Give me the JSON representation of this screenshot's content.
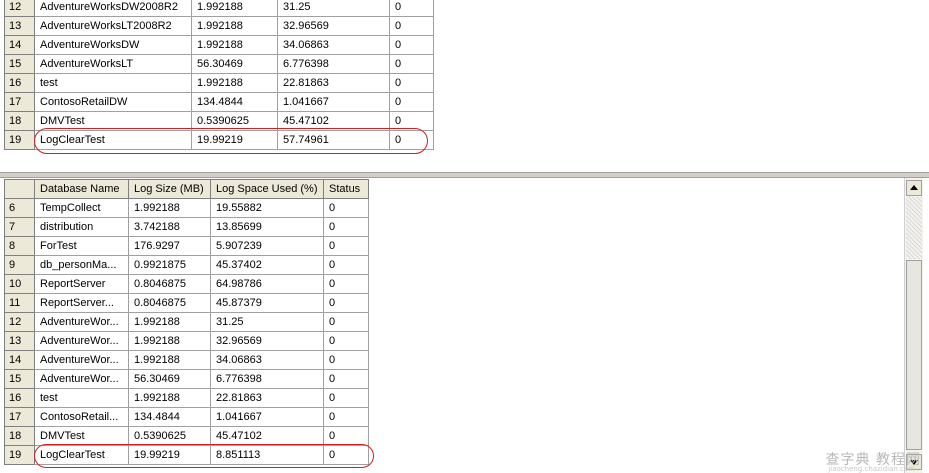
{
  "top_grid": {
    "rows": [
      {
        "n": "12",
        "name": "AdventureWorksDW2008R2",
        "size": "1.992188",
        "used": "31.25",
        "status": "0"
      },
      {
        "n": "13",
        "name": "AdventureWorksLT2008R2",
        "size": "1.992188",
        "used": "32.96569",
        "status": "0"
      },
      {
        "n": "14",
        "name": "AdventureWorksDW",
        "size": "1.992188",
        "used": "34.06863",
        "status": "0"
      },
      {
        "n": "15",
        "name": "AdventureWorksLT",
        "size": "56.30469",
        "used": "6.776398",
        "status": "0"
      },
      {
        "n": "16",
        "name": "test",
        "size": "1.992188",
        "used": "22.81863",
        "status": "0"
      },
      {
        "n": "17",
        "name": "ContosoRetailDW",
        "size": "134.4844",
        "used": "1.041667",
        "status": "0"
      },
      {
        "n": "18",
        "name": "DMVTest",
        "size": "0.5390625",
        "used": "45.47102",
        "status": "0"
      },
      {
        "n": "19",
        "name": "LogClearTest",
        "size": "19.99219",
        "used": "57.74961",
        "status": "0"
      }
    ]
  },
  "bottom_grid": {
    "headers": {
      "name": "Database Name",
      "size": "Log Size (MB)",
      "used": "Log Space Used (%)",
      "status": "Status"
    },
    "rows": [
      {
        "n": "6",
        "name": "TempCollect",
        "size": "1.992188",
        "used": "19.55882",
        "status": "0"
      },
      {
        "n": "7",
        "name": "distribution",
        "size": "3.742188",
        "used": "13.85699",
        "status": "0"
      },
      {
        "n": "8",
        "name": "ForTest",
        "size": "176.9297",
        "used": "5.907239",
        "status": "0"
      },
      {
        "n": "9",
        "name": "db_personMa...",
        "size": "0.9921875",
        "used": "45.37402",
        "status": "0"
      },
      {
        "n": "10",
        "name": "ReportServer",
        "size": "0.8046875",
        "used": "64.98786",
        "status": "0"
      },
      {
        "n": "11",
        "name": "ReportServer...",
        "size": "0.8046875",
        "used": "45.87379",
        "status": "0"
      },
      {
        "n": "12",
        "name": "AdventureWor...",
        "size": "1.992188",
        "used": "31.25",
        "status": "0"
      },
      {
        "n": "13",
        "name": "AdventureWor...",
        "size": "1.992188",
        "used": "32.96569",
        "status": "0"
      },
      {
        "n": "14",
        "name": "AdventureWor...",
        "size": "1.992188",
        "used": "34.06863",
        "status": "0"
      },
      {
        "n": "15",
        "name": "AdventureWor...",
        "size": "56.30469",
        "used": "6.776398",
        "status": "0"
      },
      {
        "n": "16",
        "name": "test",
        "size": "1.992188",
        "used": "22.81863",
        "status": "0"
      },
      {
        "n": "17",
        "name": "ContosoRetail...",
        "size": "134.4844",
        "used": "1.041667",
        "status": "0"
      },
      {
        "n": "18",
        "name": "DMVTest",
        "size": "0.5390625",
        "used": "45.47102",
        "status": "0"
      },
      {
        "n": "19",
        "name": "LogClearTest",
        "size": "19.99219",
        "used": "8.851113",
        "status": "0"
      }
    ]
  },
  "scrollbar": {
    "up_icon": "arrow-up-icon",
    "down_icon": "arrow-down-icon"
  },
  "watermark": {
    "text": "查字典 教程网",
    "sub": "jiaocheng.chazidian.com"
  },
  "colors": {
    "highlight": "#d02020",
    "header_bg": "#ece9d8",
    "grid_line": "#a0a0a0"
  }
}
